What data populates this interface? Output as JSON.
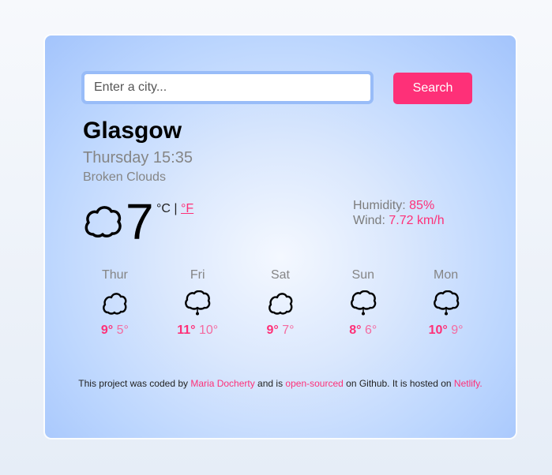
{
  "search": {
    "placeholder": "Enter a city...",
    "value": "",
    "button_label": "Search"
  },
  "current": {
    "city": "Glasgow",
    "datetime": "Thursday 15:35",
    "description": "Broken Clouds",
    "icon": "cloud-icon",
    "temperature": "7",
    "unit_celsius": "°C",
    "unit_separator": "|",
    "unit_fahrenheit": "°F",
    "humidity_label": "Humidity:",
    "humidity_value": "85%",
    "wind_label": "Wind:",
    "wind_value": "7.72 km/h"
  },
  "forecast": [
    {
      "day": "Thur",
      "icon": "cloud-icon",
      "max": "9°",
      "min": "5°"
    },
    {
      "day": "Fri",
      "icon": "rain-cloud-icon",
      "max": "11°",
      "min": "10°"
    },
    {
      "day": "Sat",
      "icon": "cloud-icon",
      "max": "9°",
      "min": "7°"
    },
    {
      "day": "Sun",
      "icon": "rain-cloud-icon",
      "max": "8°",
      "min": "6°"
    },
    {
      "day": "Mon",
      "icon": "rain-cloud-icon",
      "max": "10°",
      "min": "9°"
    }
  ],
  "footer": {
    "text1": "This project was coded by ",
    "author_link": "Maria Docherty",
    "text2": " and is ",
    "source_link": "open-sourced",
    "text3": " on Github. It is hosted on ",
    "host_link": "Netlify."
  },
  "colors": {
    "accent": "#fe3078",
    "input_border": "#98bcf8",
    "muted_text": "#858585"
  }
}
